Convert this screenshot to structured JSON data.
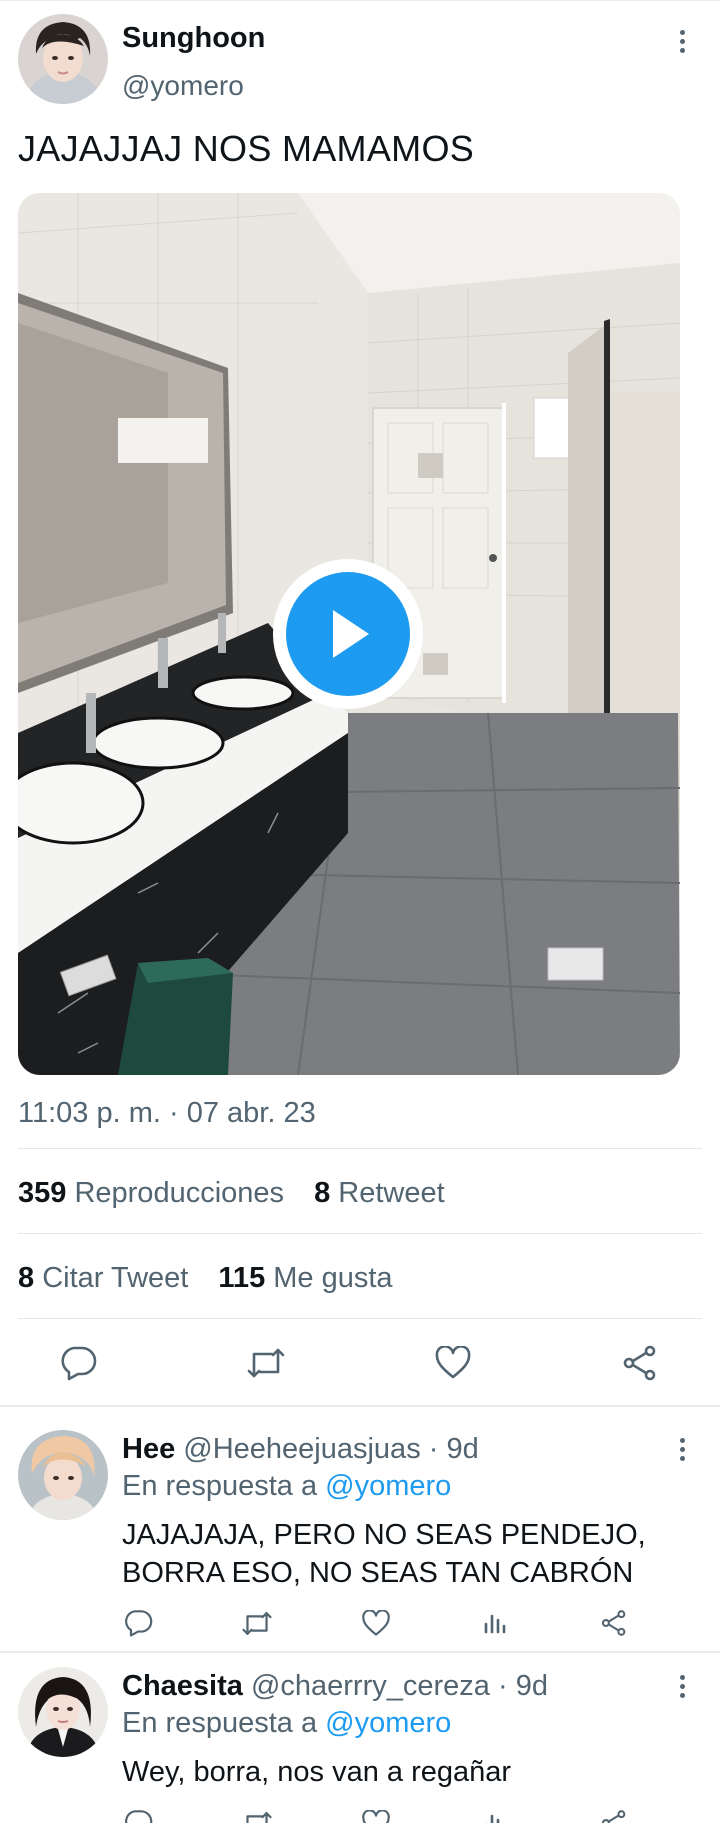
{
  "tweet": {
    "author_name": "Sunghoon",
    "author_handle": "@yomero",
    "text": "JAJAJJAJ NOS MAMAMOS",
    "media": {
      "type": "video",
      "icon": "play-icon",
      "description_icon": "video-thumbnail"
    },
    "timestamp": "11:03 p. m. · 07 abr. 23",
    "stats": {
      "views_count": "359",
      "views_label": "Reproducciones",
      "retweets_count": "8",
      "retweets_label": "Retweet",
      "quotes_count": "8",
      "quotes_label": "Citar Tweet",
      "likes_count": "115",
      "likes_label": "Me gusta"
    },
    "actions": [
      "reply-icon",
      "retweet-icon",
      "like-icon",
      "share-icon"
    ]
  },
  "replies": [
    {
      "name": "Hee",
      "handle": "@Heeheejuasjuas",
      "time": "· 9d",
      "reply_prefix": "En respuesta a",
      "reply_mention": "@yomero",
      "text_line1": "JAJAJAJA, PERO NO SEAS PENDEJO,",
      "text_line2": "BORRA ESO, NO SEAS TAN CABRÓN"
    },
    {
      "name": "Chaesita",
      "handle": "@chaerrry_cereza",
      "time": "· 9d",
      "reply_prefix": "En respuesta a",
      "reply_mention": "@yomero",
      "text_line1": "Wey, borra, nos van a regañar"
    }
  ],
  "colors": {
    "accent": "#1d9bf0",
    "secondary_text": "#536471",
    "primary_text": "#0f1419",
    "divider": "#e1e8ed"
  }
}
